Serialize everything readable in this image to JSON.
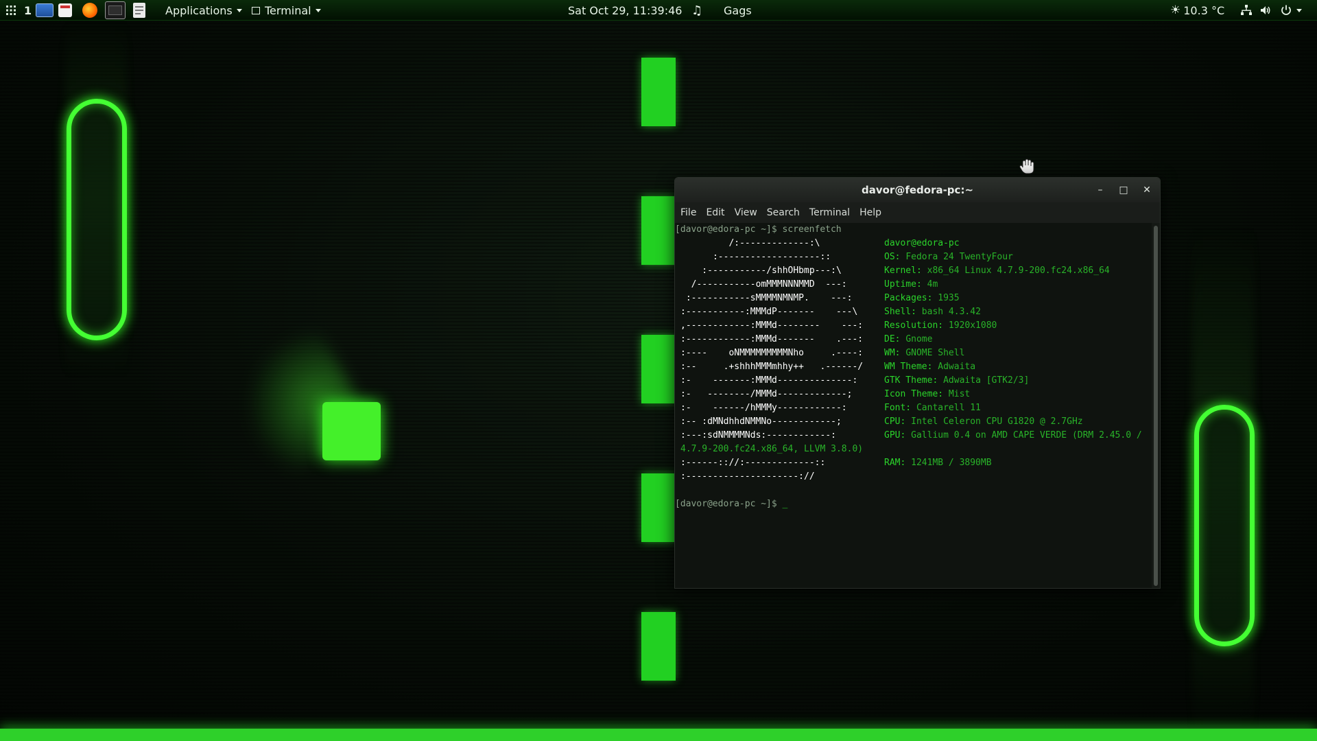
{
  "top_panel": {
    "workspace_number": "1",
    "applications_label": "Applications",
    "terminal_label": "Terminal",
    "clock": "Sat Oct 29, 11:39:46",
    "media_title": "Gags",
    "weather": "10.3 °C",
    "icons": [
      "apps-grid-icon",
      "desktop-show-icon",
      "calendar-icon",
      "firefox-icon",
      "terminal-icon",
      "text-editor-icon",
      "music-note-icon",
      "weather-sun-icon",
      "network-icon",
      "volume-icon",
      "power-icon"
    ]
  },
  "terminal": {
    "title": "davor@fedora-pc:~",
    "buttons": {
      "minimize": "–",
      "maximize": "□",
      "close": "✕"
    },
    "menu": [
      "File",
      "Edit",
      "View",
      "Search",
      "Terminal",
      "Help"
    ],
    "prompt1": "[davor@edora-pc ~]$ screenfetch",
    "art": [
      "         /:-------------:\\",
      "      :-------------------::",
      "    :-----------/shhOHbmp---:\\",
      "  /-----------omMMMNNNMMD  ---:",
      " :-----------sMMMMNMNMP.    ---:",
      ":-----------:MMMdP-------    ---\\",
      ",------------:MMMd--------    ---:",
      ":------------:MMMd-------    .---:",
      ":----    oNMMMMMMMMMNho     .----:",
      ":--     .+shhhMMMmhhy++   .------/",
      ":-    -------:MMMd--------------:",
      ":-   --------/MMMd-------------;",
      ":-    ------/hMMMy------------:",
      ":-- :dMNdhhdNMMNo------------;",
      ":---:sdNMMMMNds:------------:",
      "",
      ":------:://:-------------::",
      ":---------------------://"
    ],
    "gpu_wrap": "4.7.9-200.fc24.x86_64, LLVM 3.8.0)",
    "userhost": "davor@edora-pc",
    "info": [
      {
        "key": "OS:",
        "value": "Fedora 24 TwentyFour"
      },
      {
        "key": "Kernel:",
        "value": "x86_64 Linux 4.7.9-200.fc24.x86_64"
      },
      {
        "key": "Uptime:",
        "value": "4m"
      },
      {
        "key": "Packages:",
        "value": "1935"
      },
      {
        "key": "Shell:",
        "value": "bash 4.3.42"
      },
      {
        "key": "Resolution:",
        "value": "1920x1080"
      },
      {
        "key": "DE:",
        "value": "Gnome"
      },
      {
        "key": "WM:",
        "value": "GNOME Shell"
      },
      {
        "key": "WM Theme:",
        "value": "Adwaita"
      },
      {
        "key": "GTK Theme:",
        "value": "Adwaita [GTK2/3]"
      },
      {
        "key": "Icon Theme:",
        "value": "Mist"
      },
      {
        "key": "Font:",
        "value": "Cantarell 11"
      },
      {
        "key": "CPU:",
        "value": "Intel Celeron CPU G1820 @ 2.7GHz"
      },
      {
        "key": "GPU:",
        "value": "Gallium 0.4 on AMD CAPE VERDE (DRM 2.45.0 /"
      },
      {
        "key": "RAM:",
        "value": "1241MB / 3890MB"
      }
    ],
    "prompt2": "[davor@edora-pc ~]$ ",
    "cursor": "_"
  },
  "colors": {
    "neon_green": "#44ff33",
    "terminal_green": "#2bd42b",
    "panel_bg": "#0a2a0a"
  }
}
